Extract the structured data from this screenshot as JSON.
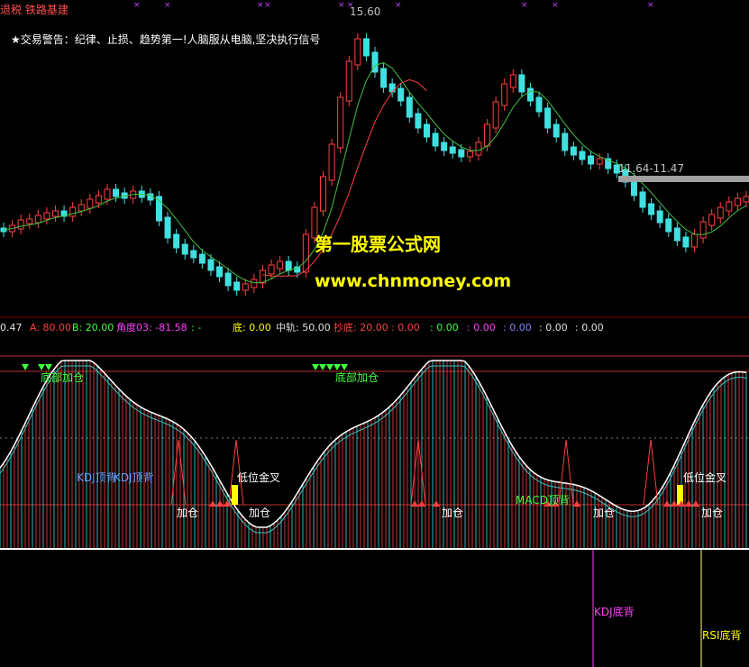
{
  "window": {
    "title": "退税 铁路基建"
  },
  "notice": "★交易警告：纪律、止损、趋势第一!人脑服从电脑,坚决执行信号",
  "price": {
    "high_label": "15.60",
    "range_label": "11.64-11.47"
  },
  "watermark": {
    "line1": "第一股票公式网",
    "line2": "www.chnmoney.com"
  },
  "indicator": {
    "items": [
      {
        "text": "0.47",
        "color": "#e0e0e0"
      },
      {
        "text": "A: 80.00",
        "color": "#ff4040"
      },
      {
        "text": "B: 20.00",
        "color": "#40ff40"
      },
      {
        "text": "角度03: -81.58",
        "color": "#ff40ff"
      },
      {
        "text": ": -",
        "color": "#40ff40"
      },
      {
        "text": "底: 0.00",
        "color": "#ffff00"
      },
      {
        "text": "中轨: 50.00",
        "color": "#e0e0e0"
      },
      {
        "text": "抄底: 20.00",
        "color": "#ff4040"
      },
      {
        "text": ": 0.00",
        "color": "#ff4040"
      },
      {
        "text": ": 0.00",
        "color": "#40ff40"
      },
      {
        "text": ": 0.00",
        "color": "#ff40ff"
      },
      {
        "text": ": 0.00",
        "color": "#8080ff"
      },
      {
        "text": ": 0.00",
        "color": "#e0e0e0"
      },
      {
        "text": ": 0.00",
        "color": "#e0e0e0"
      }
    ]
  },
  "signals": {
    "bottom_add_1": "底部加仓",
    "bottom_add_2": "底部加仓",
    "kdj_top": "KDJ顶背",
    "kdj_top2": "KDJ顶背",
    "low_gold_1": "低位金叉",
    "low_gold_2": "低位金叉",
    "add_1": "加仓",
    "add_2": "加仓",
    "add_3": "加仓",
    "add_4": "加仓",
    "add_5": "加仓",
    "macd_top": "MACD顶背",
    "kdj_bottom": "KDJ底背",
    "rsi_bottom": "RSI底背"
  },
  "colors": {
    "up": "#ff4040",
    "down": "#40e0e0",
    "ma": "#40c040",
    "ma2": "#ff4040",
    "kline": "#ffffff",
    "signal": "#ffff00"
  }
}
